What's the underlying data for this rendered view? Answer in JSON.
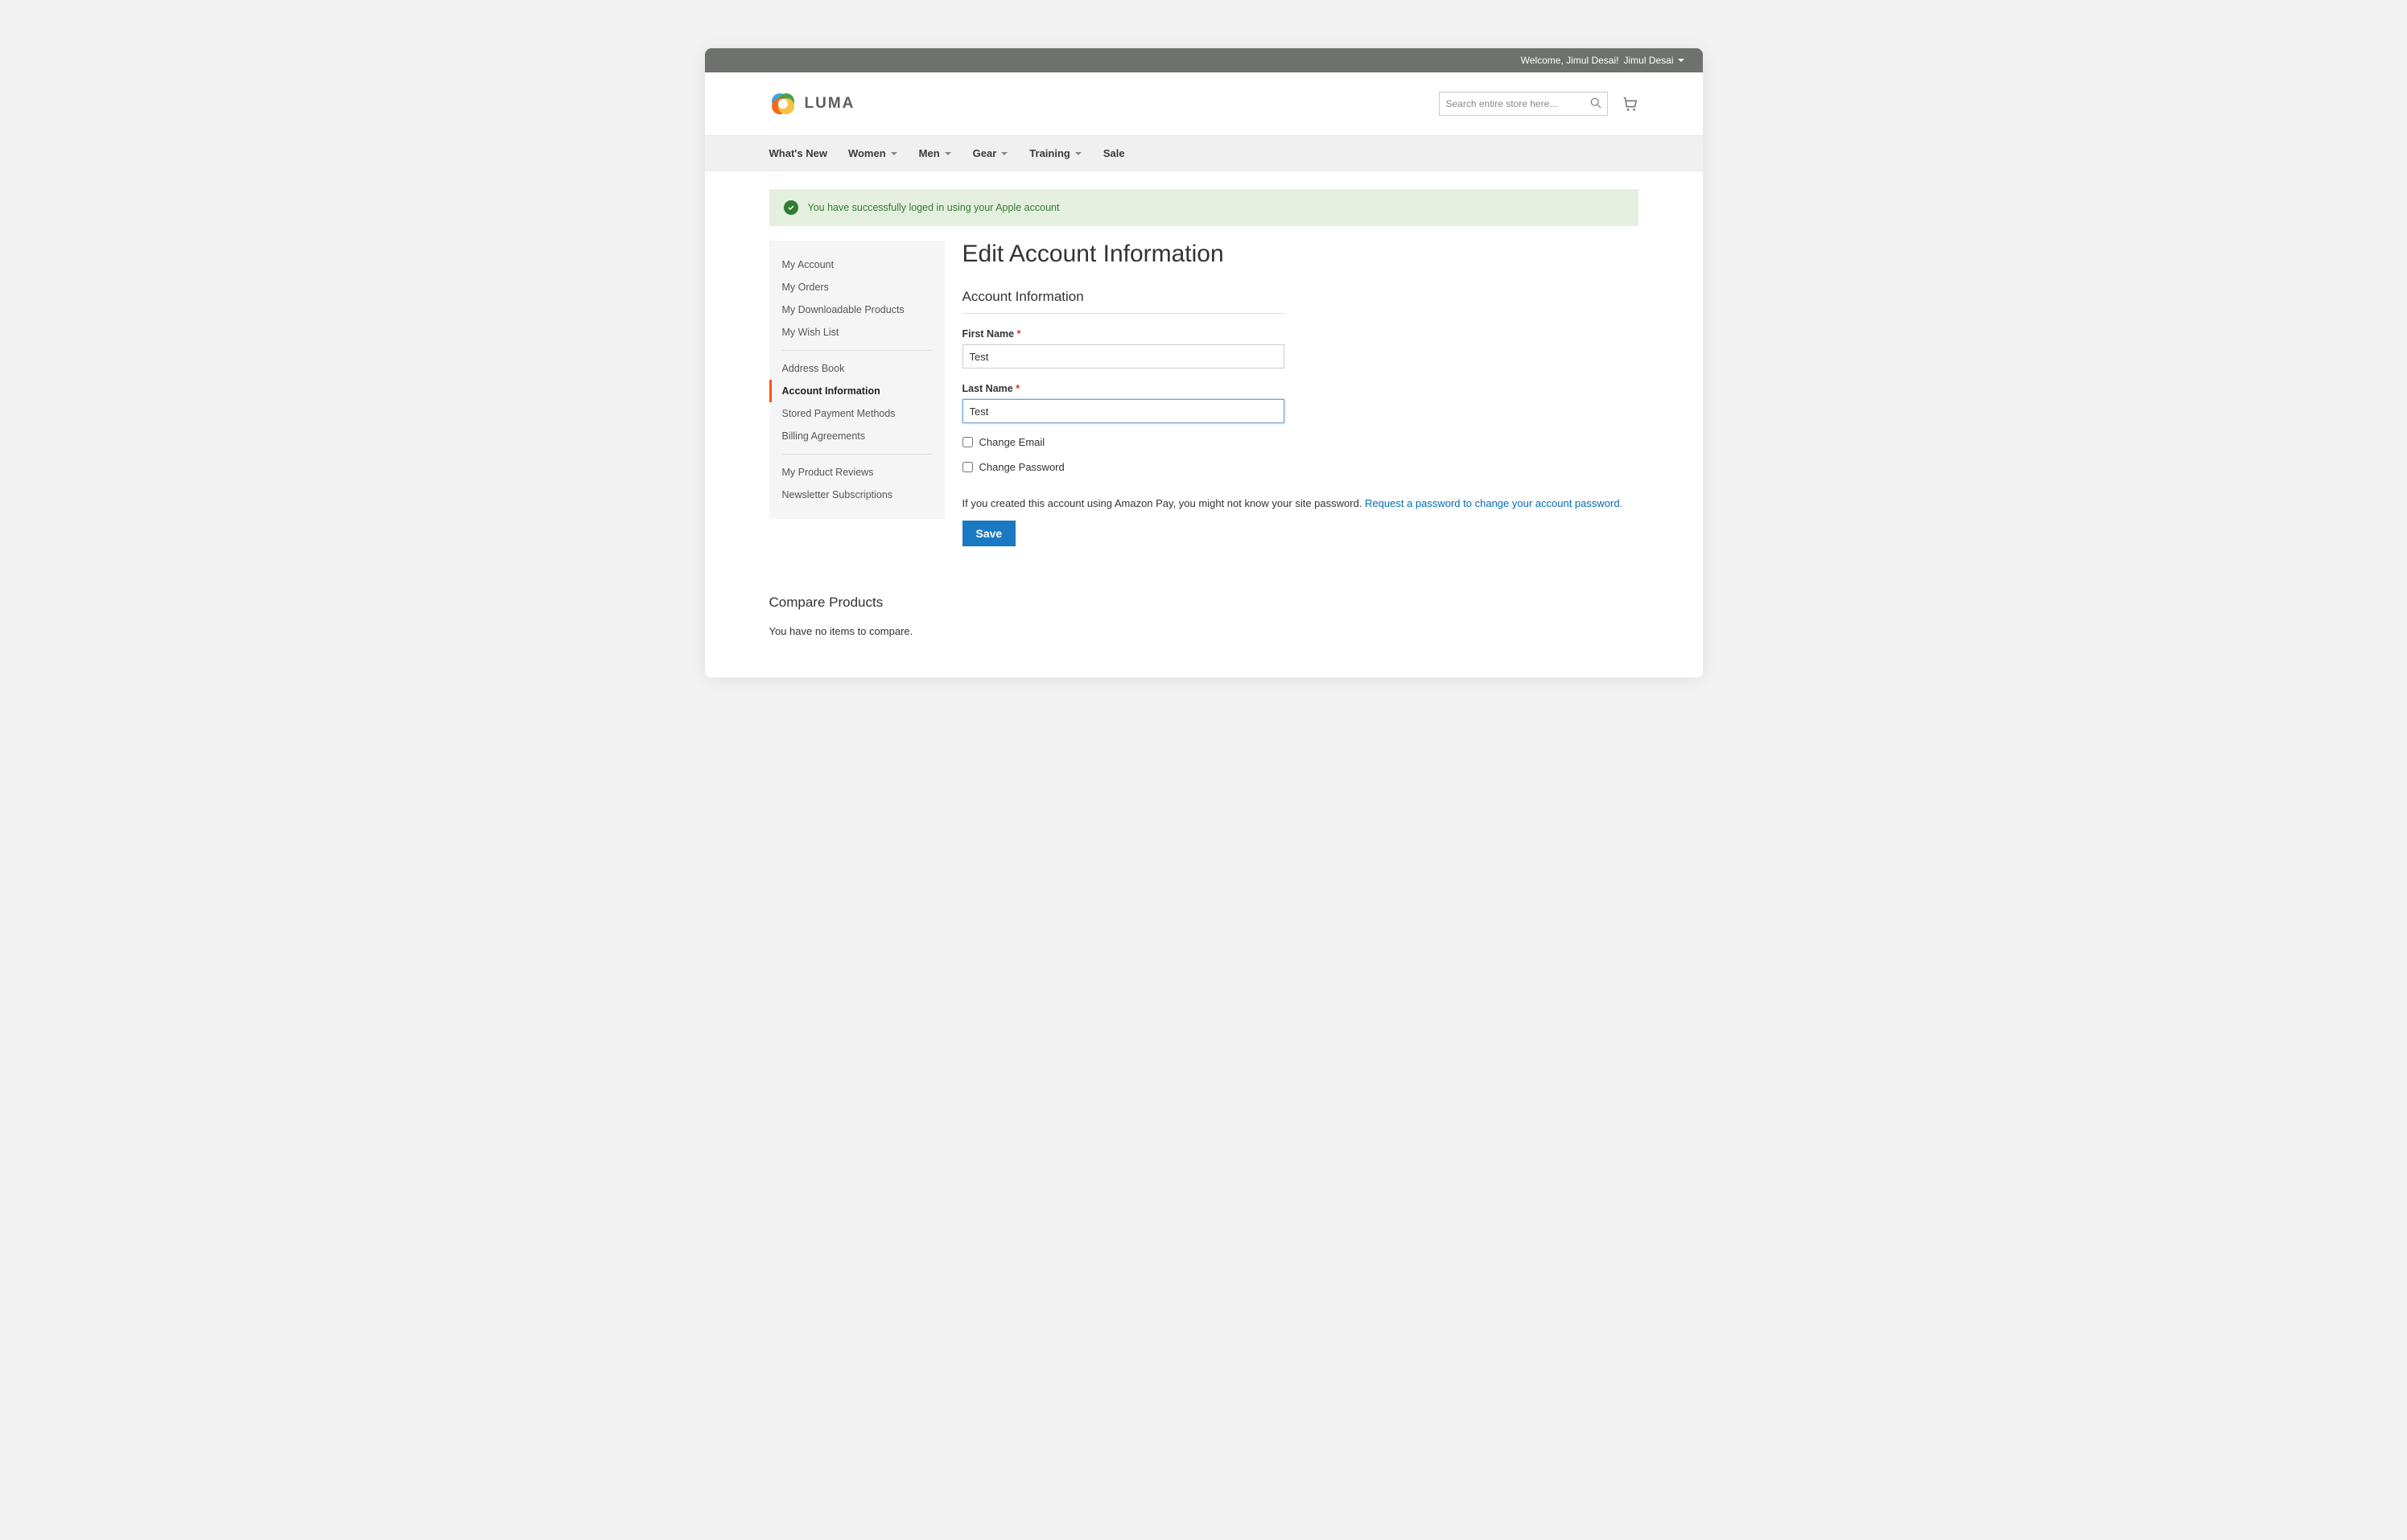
{
  "topbar": {
    "welcome": "Welcome, Jimul Desai!",
    "user_name": "Jimul Desai"
  },
  "logo": {
    "text": "LUMA"
  },
  "search": {
    "placeholder": "Search entire store here..."
  },
  "menu": {
    "whats_new": "What's New",
    "women": "Women",
    "men": "Men",
    "gear": "Gear",
    "training": "Training",
    "sale": "Sale"
  },
  "alert": {
    "text": "You have successfully loged in using your Apple account"
  },
  "sidebar": {
    "items": [
      "My Account",
      "My Orders",
      "My Downloadable Products",
      "My Wish List",
      "Address Book",
      "Account Information",
      "Stored Payment Methods",
      "Billing Agreements",
      "My Product Reviews",
      "Newsletter Subscriptions"
    ]
  },
  "page": {
    "title": "Edit Account Information",
    "section_title": "Account Information",
    "first_name_label": "First Name",
    "first_name_value": "Test",
    "last_name_label": "Last Name",
    "last_name_value": "Test",
    "change_email_label": "Change Email",
    "change_password_label": "Change Password",
    "hint_text": "If you created this account using Amazon Pay, you might not know your site password. ",
    "hint_link": "Request a password to change your account password.",
    "save_label": "Save"
  },
  "compare": {
    "title": "Compare Products",
    "empty": "You have no items to compare."
  }
}
